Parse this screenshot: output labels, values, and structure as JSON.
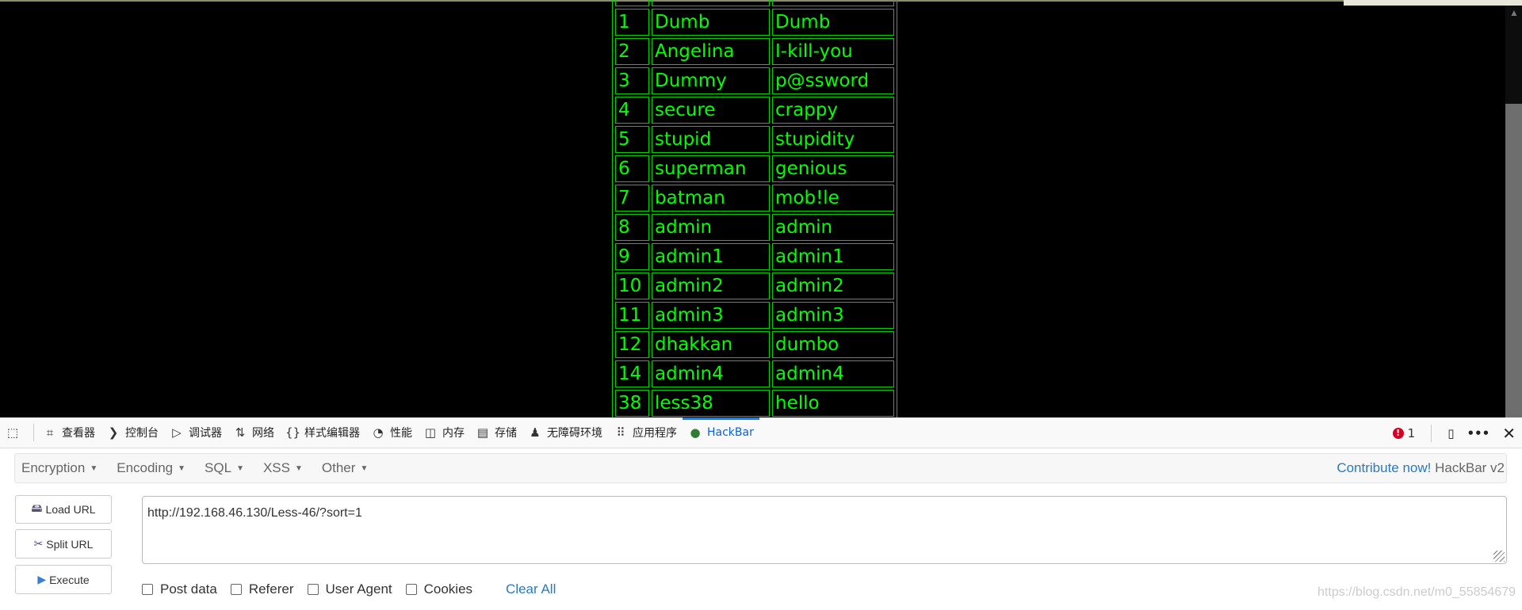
{
  "table": {
    "rows": [
      [
        "1",
        "Dumb",
        "Dumb"
      ],
      [
        "2",
        "Angelina",
        "I-kill-you"
      ],
      [
        "3",
        "Dummy",
        "p@ssword"
      ],
      [
        "4",
        "secure",
        "crappy"
      ],
      [
        "5",
        "stupid",
        "stupidity"
      ],
      [
        "6",
        "superman",
        "genious"
      ],
      [
        "7",
        "batman",
        "mob!le"
      ],
      [
        "8",
        "admin",
        "admin"
      ],
      [
        "9",
        "admin1",
        "admin1"
      ],
      [
        "10",
        "admin2",
        "admin2"
      ],
      [
        "11",
        "admin3",
        "admin3"
      ],
      [
        "12",
        "dhakkan",
        "dumbo"
      ],
      [
        "14",
        "admin4",
        "admin4"
      ],
      [
        "38",
        "less38",
        "hello"
      ]
    ]
  },
  "devtools": {
    "tabs": [
      {
        "label": "查看器",
        "icon": "inspector-icon"
      },
      {
        "label": "控制台",
        "icon": "console-icon"
      },
      {
        "label": "调试器",
        "icon": "debugger-icon"
      },
      {
        "label": "网络",
        "icon": "network-icon"
      },
      {
        "label": "样式编辑器",
        "icon": "style-editor-icon"
      },
      {
        "label": "性能",
        "icon": "performance-icon"
      },
      {
        "label": "内存",
        "icon": "memory-icon"
      },
      {
        "label": "存储",
        "icon": "storage-icon"
      },
      {
        "label": "无障碍环境",
        "icon": "accessibility-icon"
      },
      {
        "label": "应用程序",
        "icon": "application-icon"
      },
      {
        "label": "HackBar",
        "icon": "hackbar-icon",
        "active": true
      }
    ],
    "error_count": "1"
  },
  "hackbar": {
    "menus": [
      "Encryption",
      "Encoding",
      "SQL",
      "XSS",
      "Other"
    ],
    "contribute": "Contribute now!",
    "version": "HackBar v2",
    "buttons": {
      "load": "Load URL",
      "split": "Split URL",
      "execute": "Execute"
    },
    "url": "http://192.168.46.130/Less-46/?sort=1",
    "options": [
      "Post data",
      "Referer",
      "User Agent",
      "Cookies"
    ],
    "clear_all": "Clear All"
  },
  "watermark": "https://blog.csdn.net/m0_55854679",
  "colors": {
    "table_text": "#00ff00",
    "accent": "#0a84ff",
    "link": "#2a7ac0"
  }
}
